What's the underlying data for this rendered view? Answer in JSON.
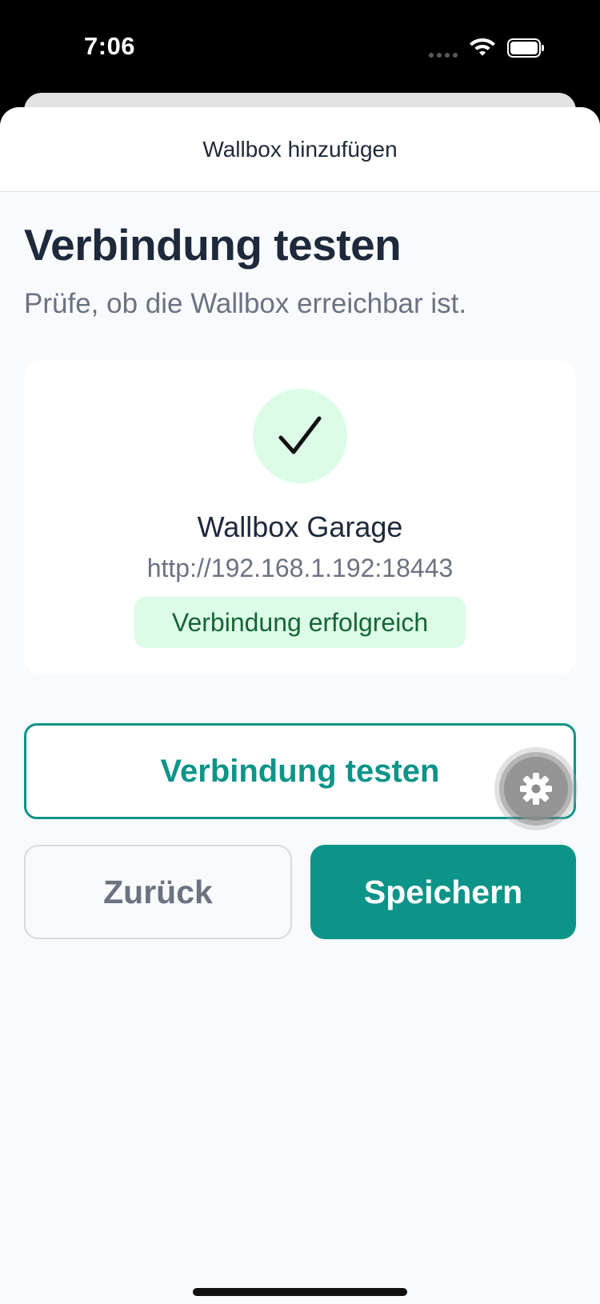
{
  "status_bar": {
    "time": "7:06"
  },
  "header": {
    "title": "Wallbox hinzufügen"
  },
  "main": {
    "heading": "Verbindung testen",
    "subtitle": "Prüfe, ob die Wallbox erreichbar ist.",
    "card": {
      "icon": "checkmark-icon",
      "device_name": "Wallbox Garage",
      "device_url": "http://192.168.1.192:18443",
      "status_badge": "Verbindung erfolgreich"
    },
    "test_button_label": "Verbindung testen",
    "back_button_label": "Zurück",
    "save_button_label": "Speichern"
  },
  "floating_button": {
    "icon": "gear-icon"
  },
  "colors": {
    "accent": "#0d9488",
    "success_bg": "#dcfce7",
    "success_text": "#166534",
    "heading": "#1e293b",
    "muted": "#6b7280"
  }
}
